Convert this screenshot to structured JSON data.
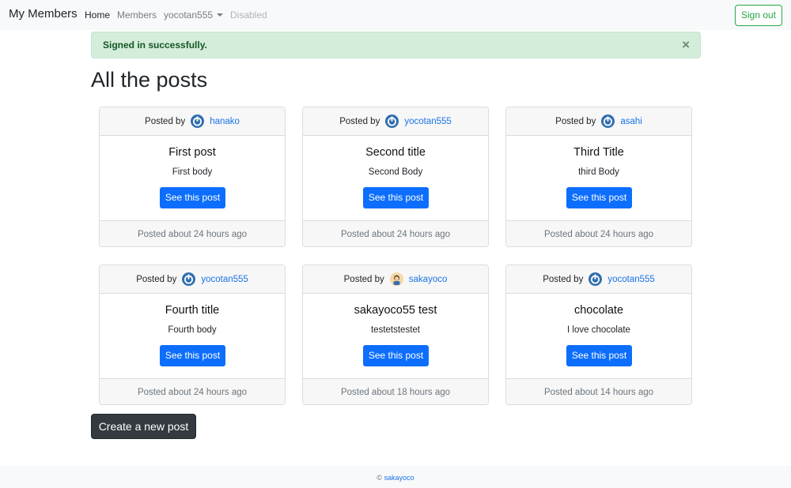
{
  "navbar": {
    "brand": "My Members",
    "links": {
      "home": "Home",
      "members": "Members",
      "user": "yocotan555",
      "disabled": "Disabled"
    },
    "signout_label": "Sign out"
  },
  "alert": {
    "message": "Signed in successfully.",
    "close_glyph": "×"
  },
  "page": {
    "title": "All the posts"
  },
  "posts": [
    {
      "posted_by": "Posted by",
      "author": "hanako",
      "title": "First post",
      "body": "First body",
      "button": "See this post",
      "footer": "Posted about 24 hours ago",
      "avatar": "power-avatar"
    },
    {
      "posted_by": "Posted by",
      "author": "yocotan555",
      "title": "Second title",
      "body": "Second Body",
      "button": "See this post",
      "footer": "Posted about 24 hours ago",
      "avatar": "power-avatar"
    },
    {
      "posted_by": "Posted by",
      "author": "asahi",
      "title": "Third Title",
      "body": "third Body",
      "button": "See this post",
      "footer": "Posted about 24 hours ago",
      "avatar": "power-avatar"
    },
    {
      "posted_by": "Posted by",
      "author": "yocotan555",
      "title": "Fourth title",
      "body": "Fourth body",
      "button": "See this post",
      "footer": "Posted about 24 hours ago",
      "avatar": "power-avatar"
    },
    {
      "posted_by": "Posted by",
      "author": "sakayoco",
      "title": "sakayoco55 test",
      "body": "testetstestet",
      "button": "See this post",
      "footer": "Posted about 18 hours ago",
      "avatar": "person-avatar"
    },
    {
      "posted_by": "Posted by",
      "author": "yocotan555",
      "title": "chocolate",
      "body": "I love chocolate",
      "button": "See this post",
      "footer": "Posted about 14 hours ago",
      "avatar": "power-avatar"
    }
  ],
  "actions": {
    "create_label": "Create a new post"
  },
  "footer": {
    "copyright": "©",
    "owner": "sakayoco"
  },
  "colors": {
    "primary": "#0d6efd",
    "success": "#28a745",
    "dark": "#343a40",
    "link": "#1a73e8",
    "alert_bg": "#d4edda"
  }
}
